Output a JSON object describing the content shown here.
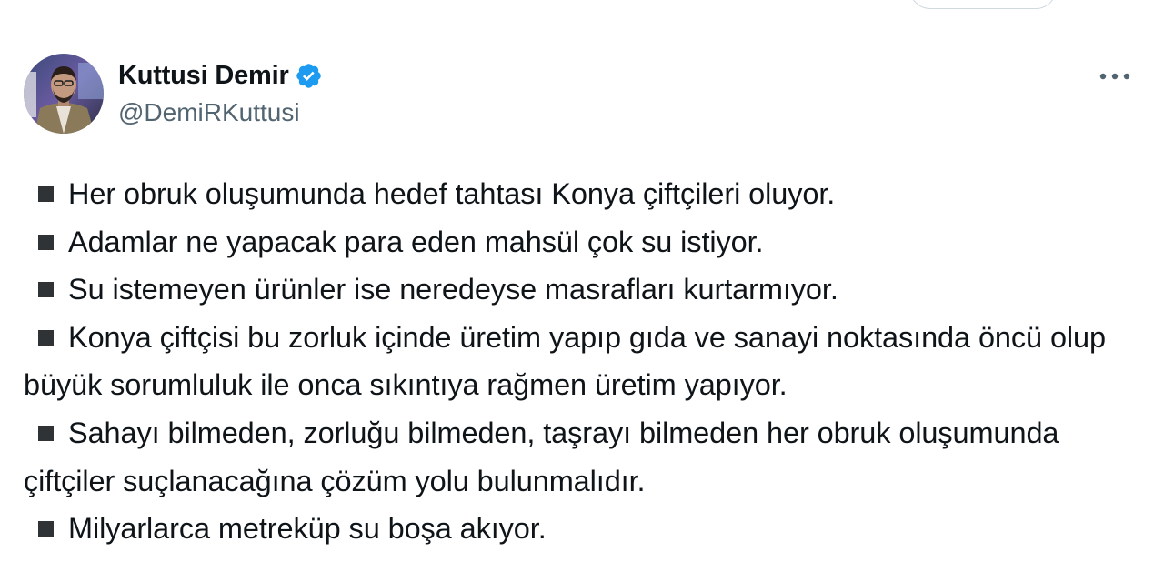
{
  "author": {
    "display_name": "Kuttusi Demir",
    "handle": "@DemiRKuttusi",
    "verified_icon": "verified-badge-icon",
    "verified_color": "#1d9bf0"
  },
  "menu": {
    "more_icon": "more-horizontal-icon"
  },
  "tweet": {
    "bullet_icon": "black-square-icon",
    "lines": [
      "Her obruk oluşumunda hedef tahtası Konya çiftçileri oluyor.",
      "Adamlar ne yapacak para eden mahsül çok su istiyor.",
      "Su istemeyen ürünler ise neredeyse masrafları kurtarmıyor.",
      "Konya çiftçisi bu zorluk içinde üretim yapıp gıda ve sanayi noktasında öncü olup büyük sorumluluk ile onca sıkıntıya rağmen üretim yapıyor.",
      "Sahayı bilmeden, zorluğu bilmeden, taşrayı bilmeden her obruk oluşumunda çiftçiler suçlanacağına çözüm yolu bulunmalıdır.",
      "Milyarlarca metreküp su boşa akıyor."
    ]
  },
  "colors": {
    "text": "#0f1419",
    "secondary_text": "#536471",
    "bullet": "#2f3336"
  }
}
